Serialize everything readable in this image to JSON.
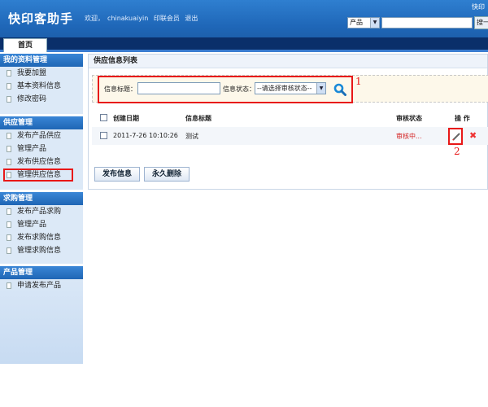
{
  "header": {
    "logo": "快印客助手",
    "welcome": "欢迎，",
    "username": "chinakuaiyin",
    "member_link": "印联会员",
    "logout_link": "退出",
    "top_right_link": "快印",
    "search_category": "产品",
    "search_input_value": "",
    "search_button": "搜一"
  },
  "tabs": {
    "home": "首页"
  },
  "sidebar": {
    "sections": [
      {
        "title": "我的资料管理",
        "items": [
          "我要加盟",
          "基本资料信息",
          "修改密码"
        ]
      },
      {
        "title": "供应管理",
        "items": [
          "发布产品供应",
          "管理产品",
          "发布供应信息",
          "管理供应信息"
        ]
      },
      {
        "title": "求购管理",
        "items": [
          "发布产品求购",
          "管理产品",
          "发布求购信息",
          "管理求购信息"
        ]
      },
      {
        "title": "产品管理",
        "items": [
          "申请发布产品"
        ]
      }
    ]
  },
  "main": {
    "title": "供应信息列表",
    "filter": {
      "title_label": "信息标题：",
      "title_value": "",
      "status_label": "信息状态：",
      "status_selected": "--请选择审核状态--"
    },
    "table": {
      "headers": {
        "created": "创建日期",
        "title": "信息标题",
        "status": "审核状态",
        "ops": "操 作"
      },
      "rows": [
        {
          "created": "2011-7-26 10:10:26",
          "title": "测试",
          "status": "审核中..."
        }
      ]
    },
    "buttons": {
      "publish": "发布信息",
      "delete": "永久删除"
    }
  },
  "annotations": {
    "marker_1": "1",
    "marker_2": "2"
  },
  "colors": {
    "header_blue": "#1f67b8",
    "highlight_red": "#e81818",
    "status_pending": "#d42020",
    "sidebar_bg": "#dce9f7"
  }
}
